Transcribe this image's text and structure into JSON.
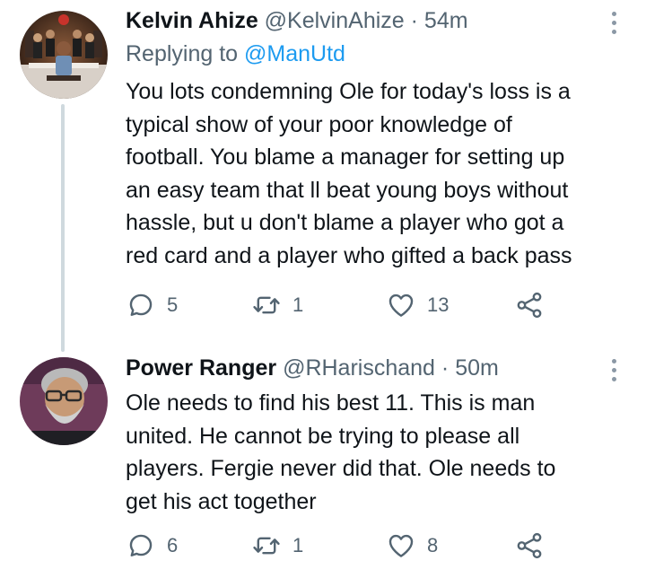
{
  "tweets": [
    {
      "display_name": "Kelvin Ahize",
      "handle": "@KelvinAhize",
      "separator": "·",
      "time": "54m",
      "replying_prefix": "Replying to",
      "replying_to": "@ManUtd",
      "body_lines": [
        "You lots condemning Ole for today's loss is a",
        "typical show of your poor knowledge of",
        "football. You blame a manager for setting up",
        "an easy team that ll beat young boys without",
        "hassle, but u don't blame a player who got a",
        "red card and a player who gifted a back pass"
      ],
      "replies": "5",
      "retweets": "1",
      "likes": "13",
      "icons": {
        "reply": "reply-icon",
        "retweet": "retweet-icon",
        "like": "heart-icon",
        "share": "share-icon",
        "more": "more-icon"
      }
    },
    {
      "display_name": "Power Ranger",
      "handle": "@RHarischand",
      "separator": "·",
      "time": "50m",
      "body_lines": [
        "Ole needs to find his best 11. This is man",
        "united. He cannot be trying to please all",
        "players. Fergie never did that. Ole needs to",
        "get his act together"
      ],
      "replies": "6",
      "retweets": "1",
      "likes": "8",
      "icons": {
        "reply": "reply-icon",
        "retweet": "retweet-icon",
        "like": "heart-icon",
        "share": "share-icon",
        "more": "more-icon"
      }
    }
  ],
  "colors": {
    "text_primary": "#0f1419",
    "text_secondary": "#536471",
    "link": "#1d9bf0",
    "thread_line": "#cfd9de"
  }
}
